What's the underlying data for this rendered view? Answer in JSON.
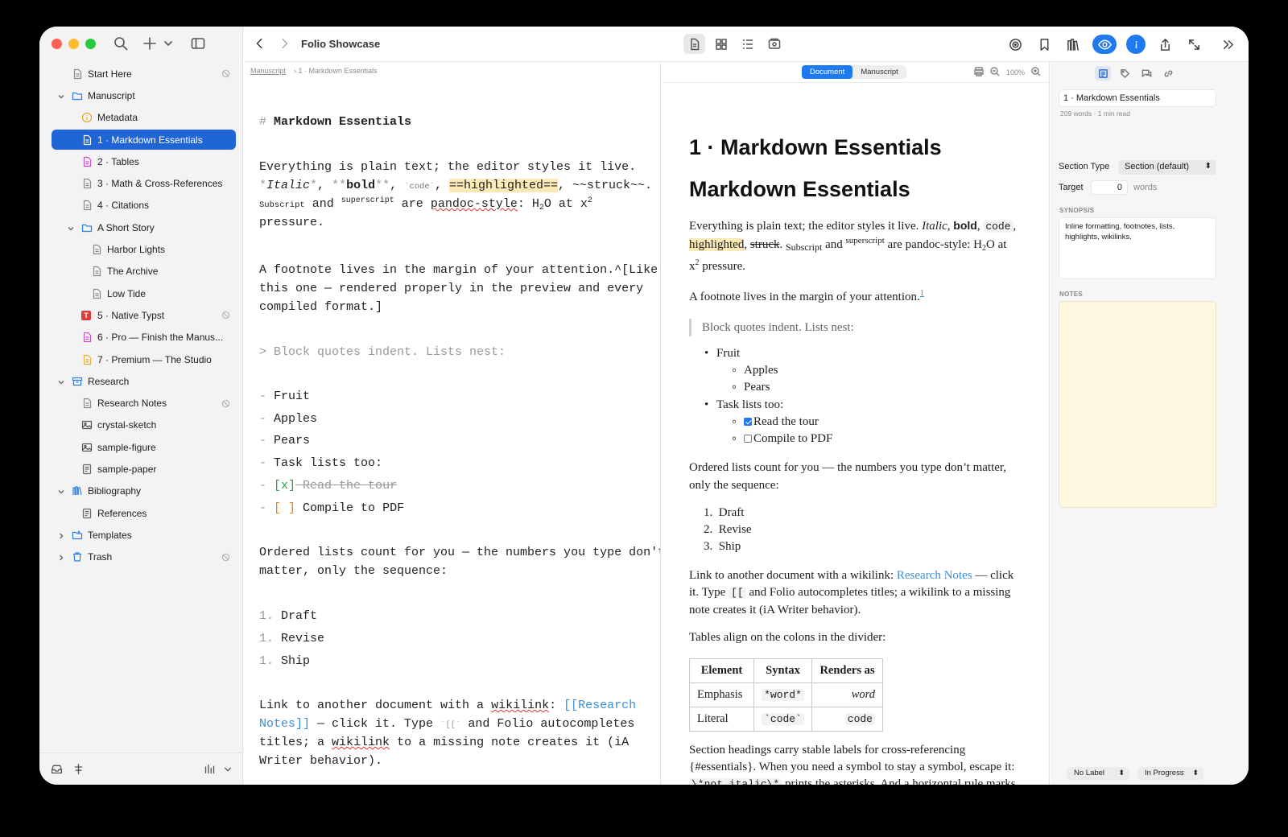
{
  "window": {
    "title": "Folio Showcase"
  },
  "sidebar": {
    "items": [
      {
        "label": "Start Here",
        "depth": 0,
        "icon": "doc-icon",
        "chev": "",
        "sym": true
      },
      {
        "label": "Manuscript",
        "depth": 0,
        "icon": "folder-icon",
        "chev": "down",
        "sym": false
      },
      {
        "label": "Metadata",
        "depth": 1,
        "icon": "info-icon",
        "chev": "",
        "sym": false
      },
      {
        "label": "1 · Markdown Essentials",
        "depth": 1,
        "icon": "doc-icon",
        "chev": "",
        "sym": false,
        "selected": true
      },
      {
        "label": "2 · Tables",
        "depth": 1,
        "icon": "doc-pink-icon",
        "chev": "",
        "sym": false
      },
      {
        "label": "3 · Math & Cross-References",
        "depth": 1,
        "icon": "doc-icon",
        "chev": "",
        "sym": false
      },
      {
        "label": "4 · Citations",
        "depth": 1,
        "icon": "doc-icon",
        "chev": "",
        "sym": false
      },
      {
        "label": "A Short Story",
        "depth": 1,
        "icon": "folder-icon",
        "chev": "down",
        "sym": false
      },
      {
        "label": "Harbor Lights",
        "depth": 2,
        "icon": "doc-icon",
        "chev": "",
        "sym": false
      },
      {
        "label": "The Archive",
        "depth": 2,
        "icon": "doc-icon",
        "chev": "",
        "sym": false
      },
      {
        "label": "Low Tide",
        "depth": 2,
        "icon": "doc-icon",
        "chev": "",
        "sym": false
      },
      {
        "label": "5 · Native Typst",
        "depth": 1,
        "icon": "typst-icon",
        "chev": "",
        "sym": true
      },
      {
        "label": "6 · Pro — Finish the Manus...",
        "depth": 1,
        "icon": "doc-pink-icon",
        "chev": "",
        "sym": false
      },
      {
        "label": "7 · Premium — The Studio",
        "depth": 1,
        "icon": "doc-yellow-icon",
        "chev": "",
        "sym": false
      },
      {
        "label": "Research",
        "depth": 0,
        "icon": "box-icon",
        "chev": "down",
        "sym": false
      },
      {
        "label": "Research Notes",
        "depth": 1,
        "icon": "doc-icon",
        "chev": "",
        "sym": true
      },
      {
        "label": "crystal-sketch",
        "depth": 1,
        "icon": "image-icon",
        "chev": "",
        "sym": false
      },
      {
        "label": "sample-figure",
        "depth": 1,
        "icon": "image-icon",
        "chev": "",
        "sym": false
      },
      {
        "label": "sample-paper",
        "depth": 1,
        "icon": "pdf-icon",
        "chev": "",
        "sym": false
      },
      {
        "label": "Bibliography",
        "depth": 0,
        "icon": "books-icon",
        "chev": "down",
        "sym": false
      },
      {
        "label": "References",
        "depth": 1,
        "icon": "pdf-icon",
        "chev": "",
        "sym": false
      },
      {
        "label": "Templates",
        "depth": 0,
        "icon": "template-folder-icon",
        "chev": "right",
        "sym": false
      },
      {
        "label": "Trash",
        "depth": 0,
        "icon": "trash-icon",
        "chev": "right",
        "sym": true
      }
    ]
  },
  "editor": {
    "breadcrumb_root": "Manuscript",
    "breadcrumb_current": "› 1 · Markdown Essentials",
    "heading_mark": "#",
    "heading": "Markdown Essentials",
    "p1_l1": "Everything is plain text; the editor styles it live.",
    "p1_italic": "Italic",
    "p1_bold": "bold",
    "p1_code": "code",
    "p1_hl": "==highlighted==",
    "p1_struck": "~~struck~~.",
    "p1_subscript": "Subscript",
    "p1_and": "and",
    "p1_superscript": "superscript",
    "p1_are": "are",
    "p1_pandoc": "pandoc-style",
    "p1_colon_h": ": H",
    "p1_sub2": "2",
    "p1_o_at": "O at x",
    "p1_sup2": "2",
    "p1_pressure": "pressure.",
    "p2_l1": "A footnote lives in the margin of your attention.^[Like",
    "p2_l2": "this one — rendered properly in the preview and every",
    "p2_l3": "compiled format.]",
    "quote": "> Block quotes indent. Lists nest:",
    "list_fruit": "Fruit",
    "list_apples": "Apples",
    "list_pears": "Pears",
    "list_tasks": "Task lists too:",
    "task1_mark": "[x]",
    "task1": "Read the tour",
    "task2_mark": "[ ]",
    "task2": "Compile to PDF",
    "ol_intro_l1": "Ordered lists count for you — the numbers you type don't",
    "ol_intro_l2": "matter, only the sequence:",
    "ol_num": "1.",
    "ol1": "Draft",
    "ol2": "Revise",
    "ol3": "Ship",
    "link_l1_a": "Link to another document with a",
    "link_wikilink": "wikilink",
    "link_colon": ":",
    "link_target_1": "[[Research",
    "link_target_2": "Notes]]",
    "link_l2_b": "— click it. Type",
    "link_bracket": "`[[`",
    "link_l2_c": "and Folio autocompletes",
    "link_l3_a": "titles; a",
    "link_l3_b": "to a missing note creates it (iA",
    "link_l4": "Writer behavior)."
  },
  "preview": {
    "seg_document": "Document",
    "seg_manuscript": "Manuscript",
    "zoom": "100%",
    "title": "1 · Markdown Essentials",
    "heading": "Markdown Essentials",
    "p1_a": "Everything is plain text; the editor styles it live.",
    "p1_italic": "Italic",
    "p1_bold": "bold",
    "p1_code": "code",
    "p1_hl": "highlighted",
    "p1_struck": "struck",
    "p1_sub": "Subscript",
    "p1_and": "and",
    "p1_sup": "superscript",
    "p1_are": "are pandoc-style: H",
    "p1_two": "2",
    "p1_o_at": "O at",
    "p1_x": "x",
    "p1_xsup": "2",
    "p1_pressure": "pressure.",
    "p2": "A footnote lives in the margin of your attention.",
    "p2_fn": "1",
    "quote": "Block quotes indent. Lists nest:",
    "fruit": "Fruit",
    "apples": "Apples",
    "pears": "Pears",
    "tasks": "Task lists too:",
    "task1": "Read the tour",
    "task2": "Compile to PDF",
    "ol_l1": "Ordered lists count for you — the numbers you type don’t matter,",
    "ol_l2": "only the sequence:",
    "ol": [
      "Draft",
      "Revise",
      "Ship"
    ],
    "ol_nums": [
      "1.",
      "2.",
      "3."
    ],
    "link_a": "Link to another document with a wikilink:",
    "link_target": "Research Notes",
    "link_b": "— click",
    "link_c": "it. Type",
    "link_code": "[[",
    "link_d": "and Folio autocompletes titles; a wikilink to a missing",
    "link_e": "note creates it (iA Writer behavior).",
    "tables_intro": "Tables align on the colons in the divider:",
    "table": {
      "headers": [
        "Element",
        "Syntax",
        "Renders as"
      ],
      "rows": [
        [
          "Emphasis",
          "*word*",
          "word"
        ],
        [
          "Literal",
          "`code`",
          "code"
        ]
      ]
    },
    "sec_l1": "Section headings carry stable labels for cross-referencing",
    "sec_l2": "{#essentials}. When you need a symbol to stay a symbol, escape it:",
    "sec_code": "\\*not italic\\*",
    "sec_l3": "prints the asterisks. And a horizontal rule marks"
  },
  "inspector": {
    "title": "1 · Markdown Essentials",
    "meta": "209 words · 1 min read",
    "section_type_label": "Section Type",
    "section_type_value": "Section (default)",
    "target_label": "Target",
    "target_value": "0",
    "target_unit": "words",
    "synopsis_label": "SYNOPSIS",
    "synopsis": "Inline formatting, footnotes, lists, highlights, wikilinks.",
    "notes_label": "NOTES",
    "label_select": "No Label",
    "status_select": "In Progress"
  }
}
